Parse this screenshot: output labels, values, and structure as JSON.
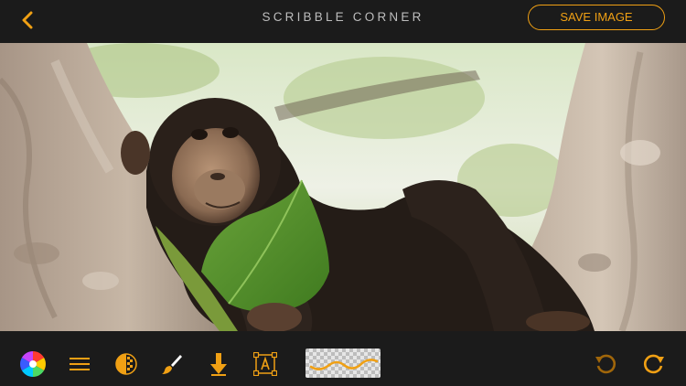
{
  "app": {
    "title": "SCRIBBLE CORNER",
    "save_label": "SAVE IMAGE",
    "accent_color": "#f0a014"
  },
  "canvas": {
    "image": "photo of a young chimpanzee resting in a tree holding a green leaf"
  },
  "toolbar": {
    "icons": [
      "color-wheel-icon",
      "menu-lines-icon",
      "opacity-icon",
      "brush-icon",
      "download-arrow-icon",
      "text-box-icon",
      "brush-preview",
      "undo-icon",
      "redo-icon"
    ]
  }
}
